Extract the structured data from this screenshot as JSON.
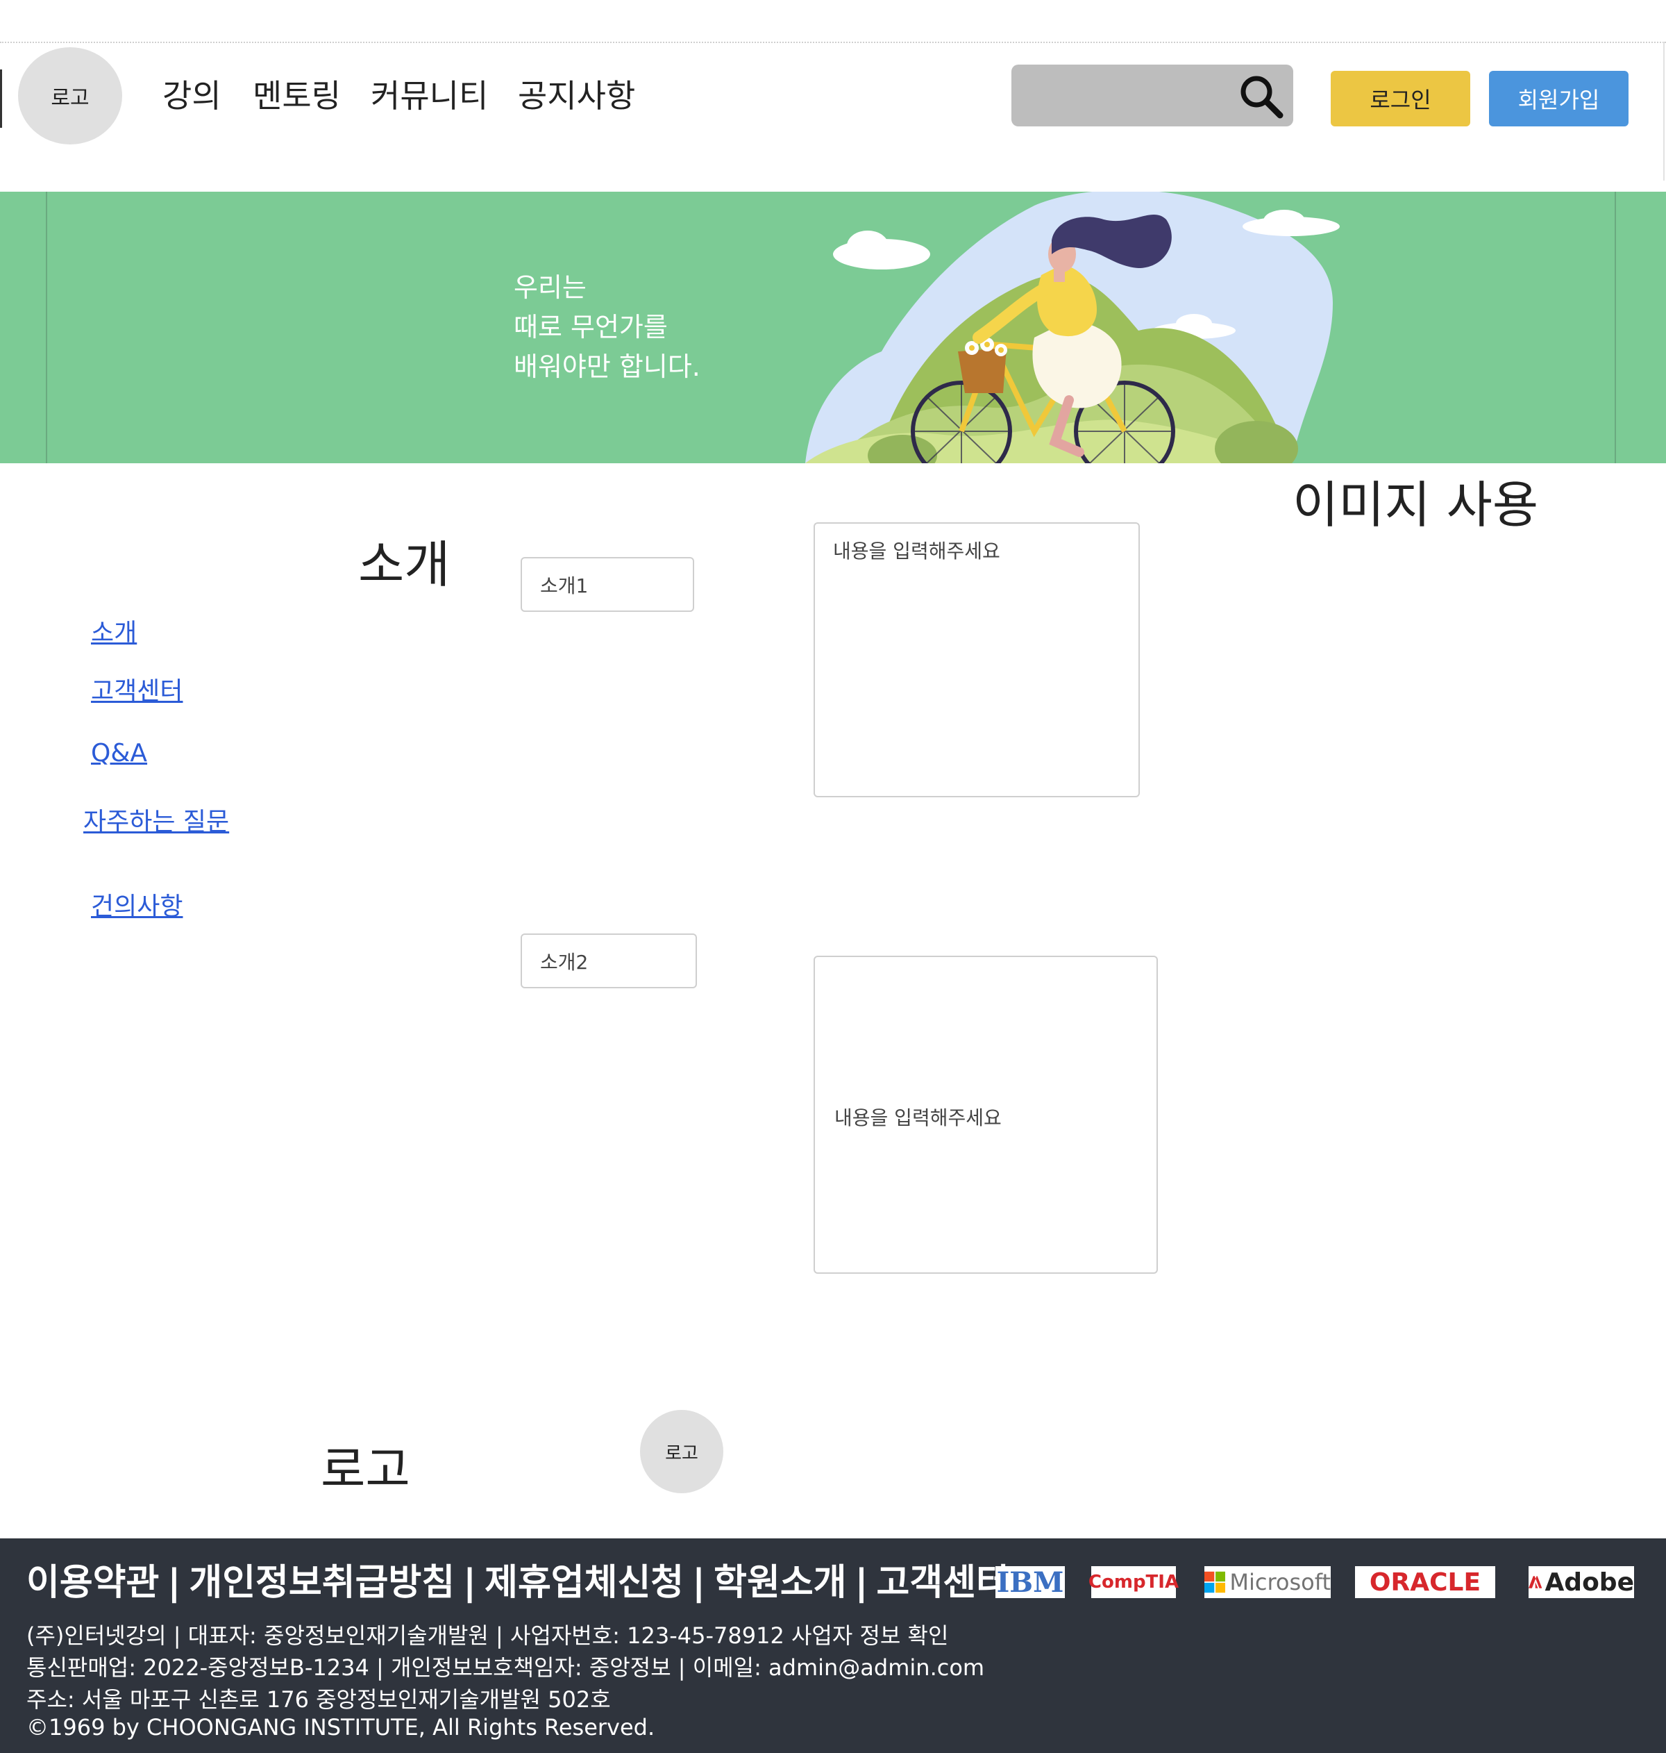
{
  "header": {
    "logo_text": "로고",
    "nav": [
      "강의",
      "멘토링",
      "커뮤니티",
      "공지사항"
    ],
    "search_value": "",
    "login_label": "로그인",
    "join_label": "회원가입"
  },
  "banner": {
    "lines": [
      "우리는",
      "때로 무언가를",
      "배워야만 합니다."
    ]
  },
  "image_note": "이미지 사용",
  "section_title": "소개",
  "sidebar": {
    "items": [
      {
        "label": "소개"
      },
      {
        "label": "고객센터"
      },
      {
        "label": "Q&A"
      },
      {
        "label": "자주하는 질문"
      },
      {
        "label": "건의사항"
      }
    ]
  },
  "form": {
    "intro1_value": "소개1",
    "intro1_content_placeholder": "내용을 입력해주세요",
    "intro2_value": "소개2",
    "intro2_content_placeholder": "내용을 입력해주세요"
  },
  "bottom_logo": {
    "label": "로고",
    "circle_text": "로고"
  },
  "footer": {
    "links": [
      "이용약관",
      "개인정보취급방침",
      "제휴업체신청",
      "학원소개",
      "고객센터"
    ],
    "separator": "|",
    "info_lines": [
      "(주)인터넷강의 | 대표자: 중앙정보인재기술개발원 | 사업자번호: 123-45-78912 사업자 정보 확인",
      "통신판매업: 2022-중앙정보B-1234 | 개인정보보호책임자: 중앙정보 | 이메일: admin@admin.com",
      "주소: 서울 마포구 신촌로 176 중앙정보인재기술개발원 502호",
      "©1969 by CHOONGANG INSTITUTE, All Rights Reserved."
    ],
    "partners": [
      {
        "name": "IBM",
        "color": "#3b6fc2"
      },
      {
        "name": "CompTIA",
        "color": "#d7272c"
      },
      {
        "name": "Microsoft",
        "color": "#737373"
      },
      {
        "name": "ORACLE",
        "color": "#d7272c"
      },
      {
        "name": "Adobe",
        "color": "#222222"
      }
    ]
  },
  "colors": {
    "login_button": "#ecc643",
    "join_button": "#4b95dd",
    "banner_bg": "#7ccb95",
    "footer_bg": "#2f343d",
    "link": "#2b5bd7"
  }
}
